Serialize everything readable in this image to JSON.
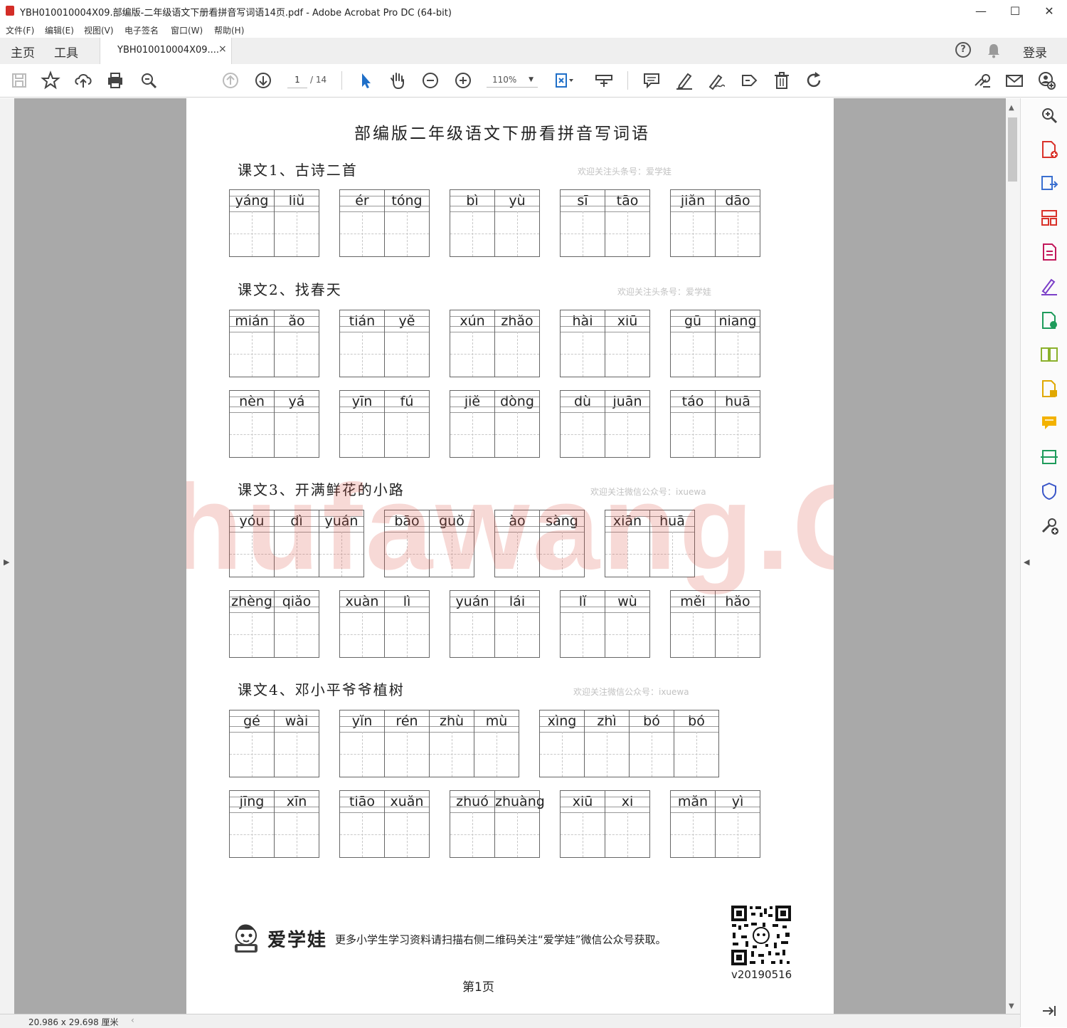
{
  "window": {
    "title": "YBH010010004X09.部编版-二年级语文下册看拼音写词语14页.pdf - Adobe Acrobat Pro DC (64-bit)",
    "minimize": "—",
    "maximize": "☐",
    "close": "✕"
  },
  "menu": [
    "文件(F)",
    "编辑(E)",
    "视图(V)",
    "电子签名",
    "窗口(W)",
    "帮助(H)"
  ],
  "tabs": {
    "home": "主页",
    "tools": "工具",
    "doc": "YBH010010004X09....",
    "doc_close": "×",
    "signin": "登录"
  },
  "toolbar": {
    "page_current": "1",
    "page_total": "/ 14",
    "zoom": "110%"
  },
  "status": {
    "dimensions": "20.986 x 29.698 厘米"
  },
  "document": {
    "title": "部编版二年级语文下册看拼音写词语",
    "watermark_big": "Shufawang.CN",
    "watermark_notes": [
      "欢迎关注头条号：爱学娃",
      "欢迎关注头条号：爱学娃",
      "欢迎关注微信公众号：ixuewa",
      "欢迎关注微信公众号：ixuewa"
    ],
    "lessons": [
      {
        "name": "课文1、古诗二首",
        "rows": [
          [
            [
              "yáng",
              "liǔ"
            ],
            [
              "ér",
              "tóng"
            ],
            [
              "bì",
              "yù"
            ],
            [
              "sī",
              "tāo"
            ],
            [
              "jiǎn",
              "dāo"
            ]
          ]
        ]
      },
      {
        "name": "课文2、找春天",
        "rows": [
          [
            [
              "mián",
              "ǎo"
            ],
            [
              "tián",
              "yě"
            ],
            [
              "xún",
              "zhǎo"
            ],
            [
              "hài",
              "xiū"
            ],
            [
              "gū",
              "niang"
            ]
          ],
          [
            [
              "nèn",
              "yá"
            ],
            [
              "yīn",
              "fú"
            ],
            [
              "jiě",
              "dòng"
            ],
            [
              "dù",
              "juān"
            ],
            [
              "táo",
              "huā"
            ]
          ]
        ]
      },
      {
        "name": "课文3、开满鲜花的小路",
        "rows": [
          [
            [
              "yóu",
              "dì",
              "yuán"
            ],
            [
              "bāo",
              "guǒ"
            ],
            [
              "ào",
              "sàng"
            ],
            [
              "xiān",
              "huā"
            ]
          ],
          [
            [
              "zhèng",
              "qiǎo"
            ],
            [
              "xuàn",
              "lì"
            ],
            [
              "yuán",
              "lái"
            ],
            [
              "lǐ",
              "wù"
            ],
            [
              "měi",
              "hǎo"
            ]
          ]
        ]
      },
      {
        "name": "课文4、邓小平爷爷植树",
        "rows": [
          [
            [
              "gé",
              "wài"
            ],
            [
              "yǐn",
              "rén",
              "zhù",
              "mù"
            ],
            [
              "xìng",
              "zhì",
              "bó",
              "bó"
            ]
          ],
          [
            [
              "jīng",
              "xīn"
            ],
            [
              "tiāo",
              "xuǎn"
            ],
            [
              "zhuó",
              "zhuàng"
            ],
            [
              "xiū",
              "xi"
            ],
            [
              "mǎn",
              "yì"
            ]
          ]
        ]
      }
    ],
    "footer": {
      "brand": "爱学娃",
      "text": "更多小学生学习资料请扫描右侧二维码关注“爱学娃”微信公众号获取。",
      "version": "v20190516",
      "page_label": "第1页"
    }
  }
}
